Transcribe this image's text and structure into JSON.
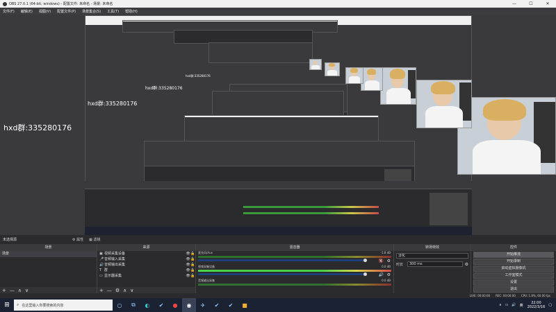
{
  "window": {
    "title": "OBS 27.0.1 (64-bit, windows) - 配置文件: 未命名 - 场景: 未命名",
    "minimize": "—",
    "maximize": "☐",
    "close": "✕"
  },
  "menu": [
    "文件(F)",
    "编辑(E)",
    "视图(V)",
    "配置文件(P)",
    "场景集合(S)",
    "工具(T)",
    "帮助(H)"
  ],
  "preview": {
    "watermark_text": "hxd群:335280176"
  },
  "status_strip": {
    "scene_name": "未选择源",
    "properties_label": "属性",
    "filters_label": "滤镜"
  },
  "scenes": {
    "title": "场景",
    "items": [
      "场景"
    ],
    "footer": [
      "+",
      "—",
      "∧",
      "∨"
    ]
  },
  "sources": {
    "title": "来源",
    "items": [
      {
        "icon": "▣",
        "name": "视频采集设备"
      },
      {
        "icon": "🎤",
        "name": "音频输入采集"
      },
      {
        "icon": "🔊",
        "name": "音频输出采集"
      },
      {
        "icon": "T",
        "name": "群"
      },
      {
        "icon": "▭",
        "name": "显示器采集"
      }
    ],
    "footer": [
      "+",
      "—",
      "⚙",
      "∧",
      "∨"
    ]
  },
  "mixer": {
    "title": "混音器",
    "channels": [
      {
        "name": "麦克风/Aux",
        "db": "-1.8 dB",
        "active": false
      },
      {
        "name": "视频采集设备",
        "db": "0.0 dB",
        "active": true
      },
      {
        "name": "音频输出采集",
        "db": "0.0 dB",
        "active": false
      }
    ]
  },
  "transitions": {
    "title": "转场特效",
    "effect": "淡化",
    "duration_label": "时长",
    "duration_value": "300 ms"
  },
  "controls": {
    "title": "控件",
    "buttons": [
      "开始推流",
      "开始录制",
      "启动虚拟摄像机",
      "工作室模式",
      "设置",
      "退出"
    ]
  },
  "status_bar": {
    "live": "LIVE: 00:00:00",
    "rec": "REC: 00:00:00",
    "cpu": "CPU: 1.8%, 60.00 fps"
  },
  "taskbar": {
    "search_placeholder": "在这里输入你要搜索的内容",
    "time": "22:00",
    "date": "2022/3/16",
    "lang": "英"
  }
}
